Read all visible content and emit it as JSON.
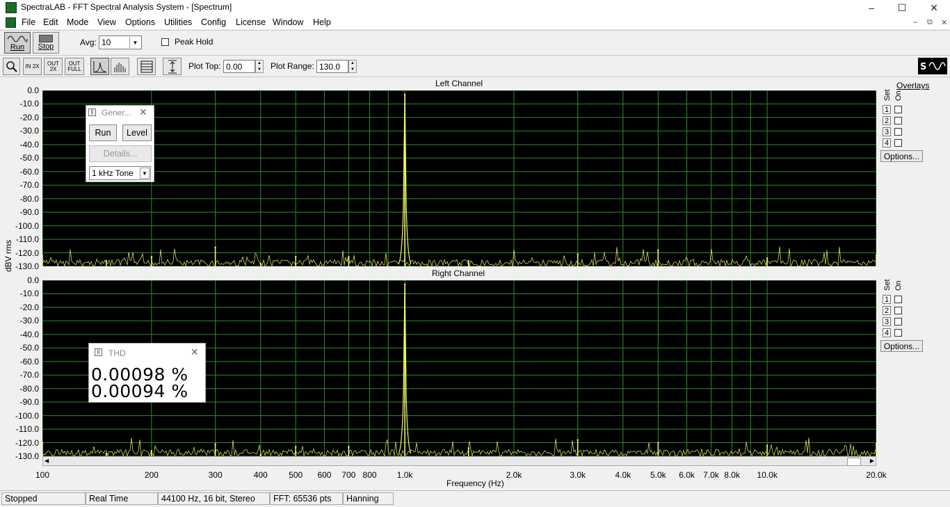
{
  "window": {
    "title": "SpectraLAB - FFT Spectral Analysis System - [Spectrum]"
  },
  "menu": [
    "File",
    "Edit",
    "Mode",
    "View",
    "Options",
    "Utilities",
    "Config",
    "License",
    "Window",
    "Help"
  ],
  "toolbar1": {
    "run_label": "Run",
    "stop_label": "Stop",
    "avg_label": "Avg:",
    "avg_value": "10",
    "peak_hold_label": "Peak Hold"
  },
  "toolbar2": {
    "zoom_in_label": "IN 2X",
    "zoom_out_label": "OUT 2X",
    "full_label": "OUT FULL",
    "plot_top_label": "Plot Top:",
    "plot_top_value": "0.00",
    "plot_range_label": "Plot Range:",
    "plot_range_value": "130.0"
  },
  "plots": {
    "left_title": "Left Channel",
    "right_title": "Right Channel",
    "ylabel": "dBV rms",
    "xlabel": "Frequency (Hz)",
    "ytick_labels": [
      "0.0",
      "-10.0",
      "-20.0",
      "-30.0",
      "-40.0",
      "-50.0",
      "-60.0",
      "-70.0",
      "-80.0",
      "-90.0",
      "-100.0",
      "-110.0",
      "-120.0",
      "-130.0"
    ],
    "xtick_labels": [
      "100",
      "200",
      "300",
      "400",
      "500",
      "600",
      "700",
      "800",
      "1.0k",
      "2.0k",
      "3.0k",
      "4.0k",
      "5.0k",
      "6.0k",
      "7.0k",
      "8.0k",
      "10.0k",
      "20.0k"
    ]
  },
  "overlays": {
    "title": "Overlays",
    "set_label": "Set",
    "on_label": "On",
    "numbers": [
      "1",
      "2",
      "3",
      "4"
    ],
    "options_label": "Options..."
  },
  "generator": {
    "title": "Gener...",
    "run_label": "Run",
    "level_label": "Level",
    "details_label": "Details...",
    "signal_value": "1 kHz Tone"
  },
  "thd": {
    "title": "THD",
    "left_value": "0.00098 %",
    "right_value": "0.00094 %"
  },
  "status": [
    "Stopped",
    "Real Time",
    "44100 Hz, 16 bit, Stereo",
    "FFT: 65536 pts",
    "Hanning"
  ],
  "colors": {
    "trace": "#ffff66",
    "grid": "#2e8b2e",
    "plot_bg": "#000000"
  },
  "chart_data": {
    "type": "line",
    "x_scale": "log",
    "xlim": [
      100,
      20000
    ],
    "ylim": [
      -130,
      0
    ],
    "series": [
      {
        "x": [
          100,
          150,
          200,
          300,
          400,
          500,
          700,
          1000,
          1500,
          3000,
          5000,
          10000,
          20000
        ],
        "y": [
          -122,
          -126,
          -123,
          -116,
          -128,
          -123,
          -123,
          -3,
          -126,
          -121,
          -118,
          -124,
          -122
        ]
      },
      {
        "x": [
          100,
          150,
          200,
          300,
          400,
          500,
          700,
          1000,
          1500,
          3000,
          5000,
          10000,
          20000
        ],
        "y": [
          -120,
          -128,
          -126,
          -121,
          -129,
          -123,
          -123,
          -3,
          -124,
          -118,
          -120,
          -122,
          -121
        ]
      }
    ]
  }
}
